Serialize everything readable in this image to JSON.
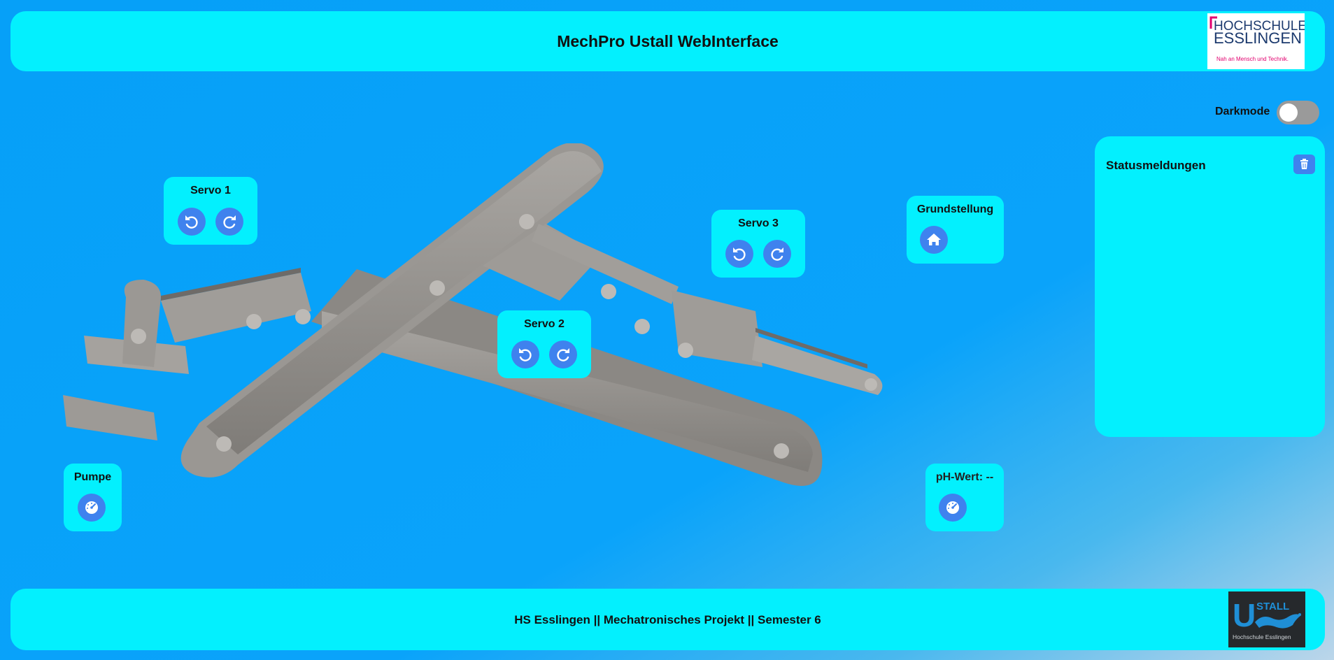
{
  "header": {
    "title": "MechPro Ustall WebInterface",
    "logo": {
      "line1": "HOCHSCHULE",
      "line2": "ESSLINGEN",
      "tagline": "Nah an Mensch und Technik."
    }
  },
  "darkmode": {
    "label": "Darkmode",
    "enabled": false
  },
  "status_panel": {
    "title": "Statusmeldungen",
    "messages": []
  },
  "controls": {
    "servo1": {
      "title": "Servo 1"
    },
    "servo2": {
      "title": "Servo 2"
    },
    "servo3": {
      "title": "Servo 3"
    },
    "home": {
      "title": "Grundstellung"
    },
    "pump": {
      "title": "Pumpe"
    },
    "ph": {
      "title": "pH-Wert: --"
    }
  },
  "footer": {
    "text": "HS Esslingen || Mechatronisches Projekt || Semester 6",
    "logo": {
      "big_letter": "U",
      "word": "STALL",
      "caption": "Hochschule Esslingen"
    }
  },
  "icons": {
    "rotate_left": "rotate-ccw-icon",
    "rotate_right": "rotate-cw-icon",
    "home": "home-icon",
    "gauge": "gauge-icon",
    "trash": "trash-icon"
  },
  "colors": {
    "panel": "#03f0fe",
    "button": "#3f82ee",
    "background": "#06a0f8"
  }
}
